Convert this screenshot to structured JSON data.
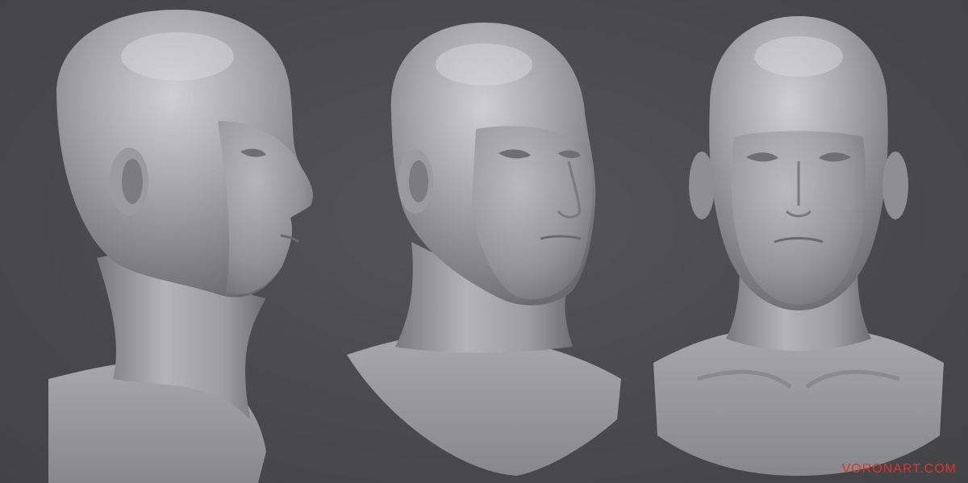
{
  "image": {
    "description_type": "3D sculpt render",
    "background_color": "#4a4a4c",
    "material_color": "#a3a3a6",
    "watermark": {
      "text": "VORONART.COM",
      "color": "#e2312a"
    },
    "views": [
      {
        "name": "side-view"
      },
      {
        "name": "three-quarter-view"
      },
      {
        "name": "front-view"
      }
    ]
  }
}
